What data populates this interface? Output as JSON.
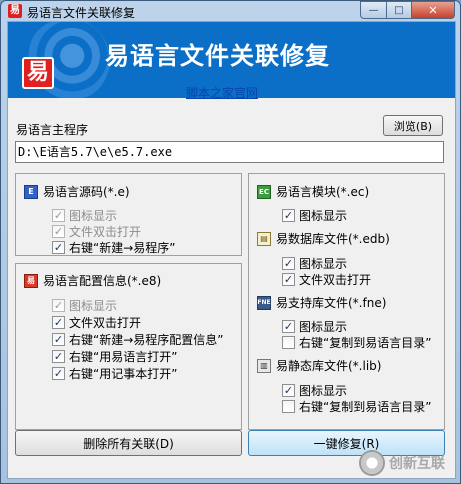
{
  "window": {
    "title": "易语言文件关联修复",
    "app_icon_glyph": "易",
    "min_glyph": "—",
    "max_glyph": "□",
    "close_glyph": "✕"
  },
  "banner": {
    "title": "易语言文件关联修复",
    "logo_glyph": "易",
    "bg_color": "#0b6fc7"
  },
  "site_link": "脚本之家官网",
  "main_program": {
    "label": "易语言主程序",
    "browse_label": "浏览(B)",
    "path_value": "D:\\E语言5.7\\e\\e5.7.exe"
  },
  "source_group": {
    "title": "易语言源码(*.e)",
    "icon_glyph": "E",
    "options": [
      {
        "label": "图标显示",
        "checked": true,
        "disabled": true
      },
      {
        "label": "文件双击打开",
        "checked": true,
        "disabled": true
      },
      {
        "label": "右键“新建→易程序”",
        "checked": true,
        "disabled": false
      }
    ]
  },
  "config_group": {
    "title": "易语言配置信息(*.e8)",
    "icon_glyph": "易",
    "options": [
      {
        "label": "图标显示",
        "checked": true,
        "disabled": true
      },
      {
        "label": "文件双击打开",
        "checked": true,
        "disabled": false
      },
      {
        "label": "右键“新建→易程序配置信息”",
        "checked": true,
        "disabled": false
      },
      {
        "label": "右键“用易语言打开”",
        "checked": true,
        "disabled": false
      },
      {
        "label": "右键“用记事本打开”",
        "checked": true,
        "disabled": false
      }
    ]
  },
  "right_group": {
    "module": {
      "title": "易语言模块(*.ec)",
      "icon_glyph": "EC",
      "options": [
        {
          "label": "图标显示",
          "checked": true
        }
      ]
    },
    "database": {
      "title": "易数据库文件(*.edb)",
      "icon_glyph": "▤",
      "options": [
        {
          "label": "图标显示",
          "checked": true
        },
        {
          "label": "文件双击打开",
          "checked": true
        }
      ]
    },
    "support_lib": {
      "title": "易支持库文件(*.fne)",
      "icon_glyph": "FNE",
      "options": [
        {
          "label": "图标显示",
          "checked": true
        },
        {
          "label": "右键“复制到易语言目录”",
          "checked": false
        }
      ]
    },
    "static_lib": {
      "title": "易静态库文件(*.lib)",
      "icon_glyph": "▥",
      "options": [
        {
          "label": "图标显示",
          "checked": true
        },
        {
          "label": "右键“复制到易语言目录”",
          "checked": false
        }
      ]
    }
  },
  "buttons": {
    "delete_all": "删除所有关联(D)",
    "repair": "一键修复(R)"
  },
  "watermark": {
    "text": "创新互联"
  }
}
